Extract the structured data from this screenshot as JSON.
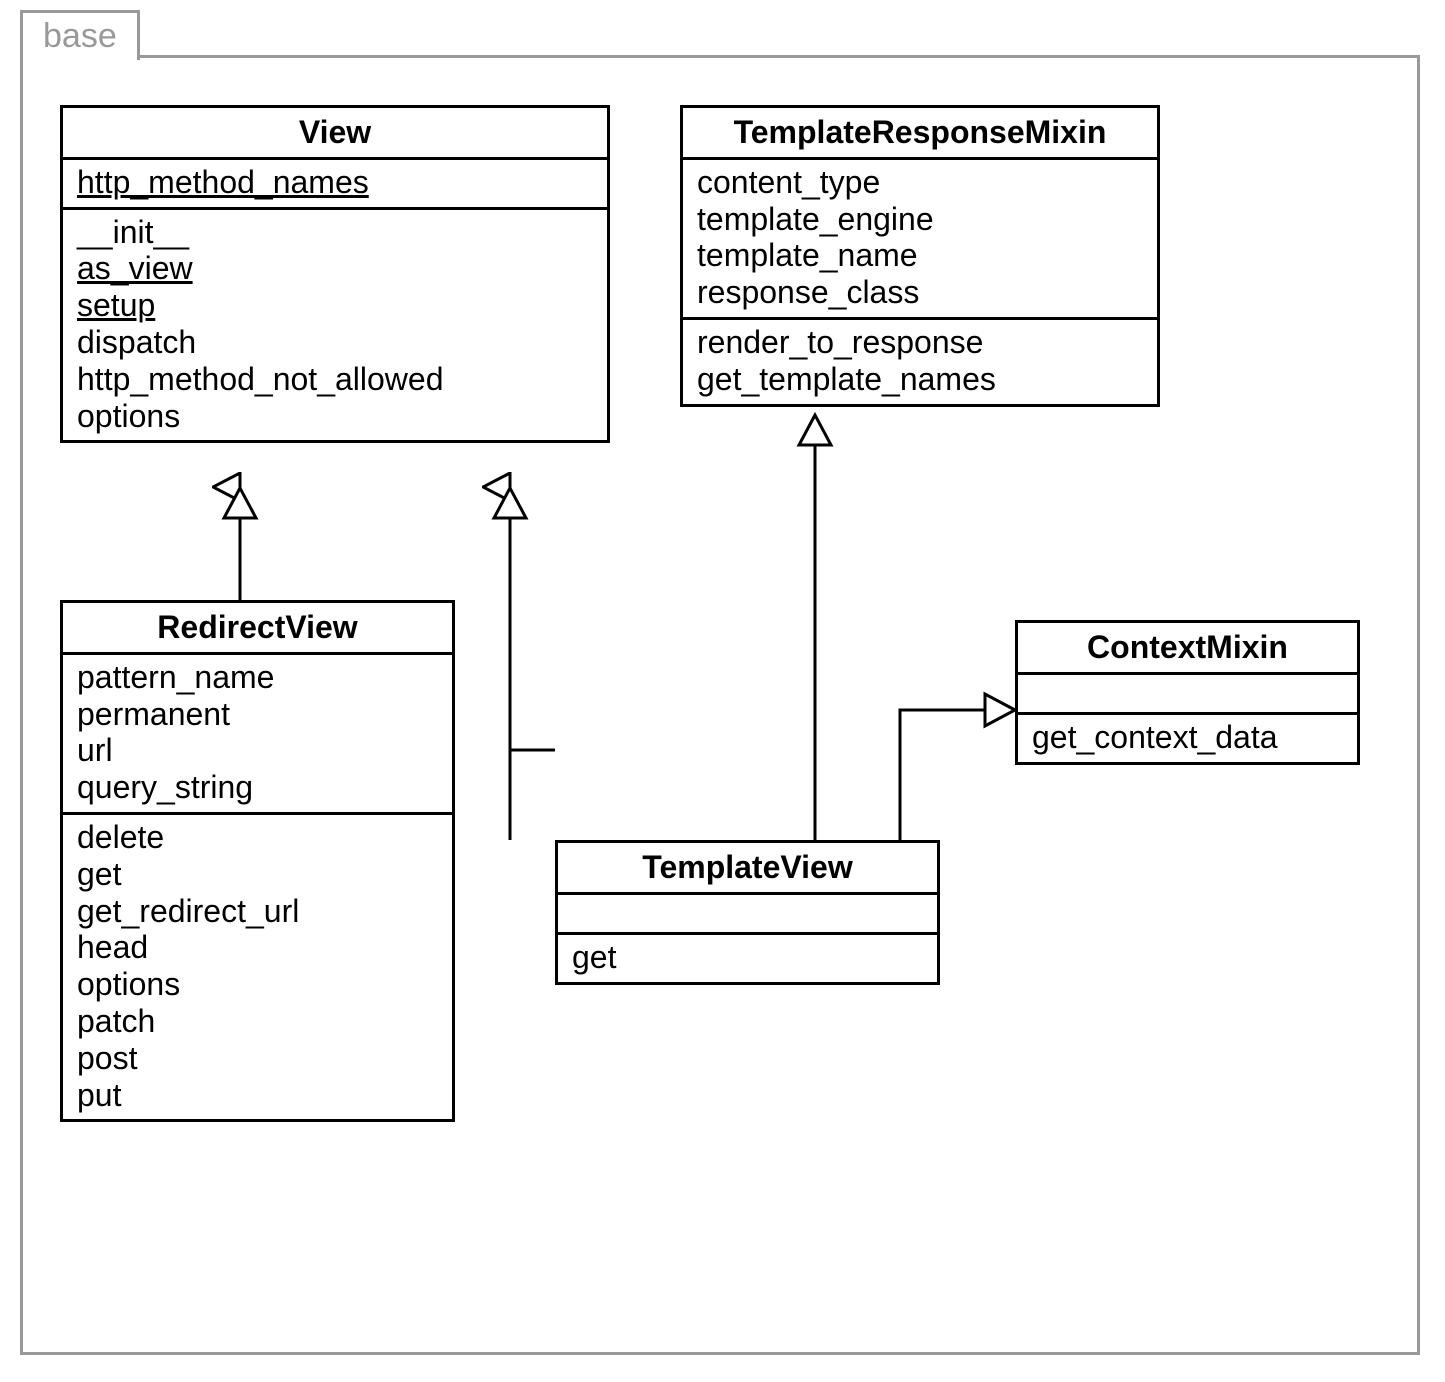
{
  "package": {
    "name": "base"
  },
  "classes": {
    "view": {
      "name": "View",
      "attributes": [
        {
          "text": "http_method_names",
          "underline": true
        }
      ],
      "methods": [
        {
          "text": "__init__",
          "underline": false
        },
        {
          "text": "as_view",
          "underline": true
        },
        {
          "text": "setup",
          "underline": true
        },
        {
          "text": "dispatch",
          "underline": false
        },
        {
          "text": "http_method_not_allowed",
          "underline": false
        },
        {
          "text": "options",
          "underline": false
        }
      ]
    },
    "templateResponseMixin": {
      "name": "TemplateResponseMixin",
      "attributes": [
        {
          "text": "content_type",
          "underline": false
        },
        {
          "text": "template_engine",
          "underline": false
        },
        {
          "text": "template_name",
          "underline": false
        },
        {
          "text": "response_class",
          "underline": false
        }
      ],
      "methods": [
        {
          "text": "render_to_response",
          "underline": false
        },
        {
          "text": "get_template_names",
          "underline": false
        }
      ]
    },
    "redirectView": {
      "name": "RedirectView",
      "attributes": [
        {
          "text": "pattern_name",
          "underline": false
        },
        {
          "text": "permanent",
          "underline": false
        },
        {
          "text": "url",
          "underline": false
        },
        {
          "text": "query_string",
          "underline": false
        }
      ],
      "methods": [
        {
          "text": "delete",
          "underline": false
        },
        {
          "text": "get",
          "underline": false
        },
        {
          "text": "get_redirect_url",
          "underline": false
        },
        {
          "text": "head",
          "underline": false
        },
        {
          "text": "options",
          "underline": false
        },
        {
          "text": "patch",
          "underline": false
        },
        {
          "text": "post",
          "underline": false
        },
        {
          "text": "put",
          "underline": false
        }
      ]
    },
    "contextMixin": {
      "name": "ContextMixin",
      "attributes": [],
      "methods": [
        {
          "text": "get_context_data",
          "underline": false
        }
      ]
    },
    "templateView": {
      "name": "TemplateView",
      "attributes": [],
      "methods": [
        {
          "text": "get",
          "underline": false
        }
      ]
    }
  },
  "relationships": [
    {
      "from": "RedirectView",
      "to": "View",
      "type": "generalization"
    },
    {
      "from": "TemplateView",
      "to": "View",
      "type": "generalization"
    },
    {
      "from": "TemplateView",
      "to": "TemplateResponseMixin",
      "type": "generalization"
    },
    {
      "from": "TemplateView",
      "to": "ContextMixin",
      "type": "generalization"
    }
  ]
}
